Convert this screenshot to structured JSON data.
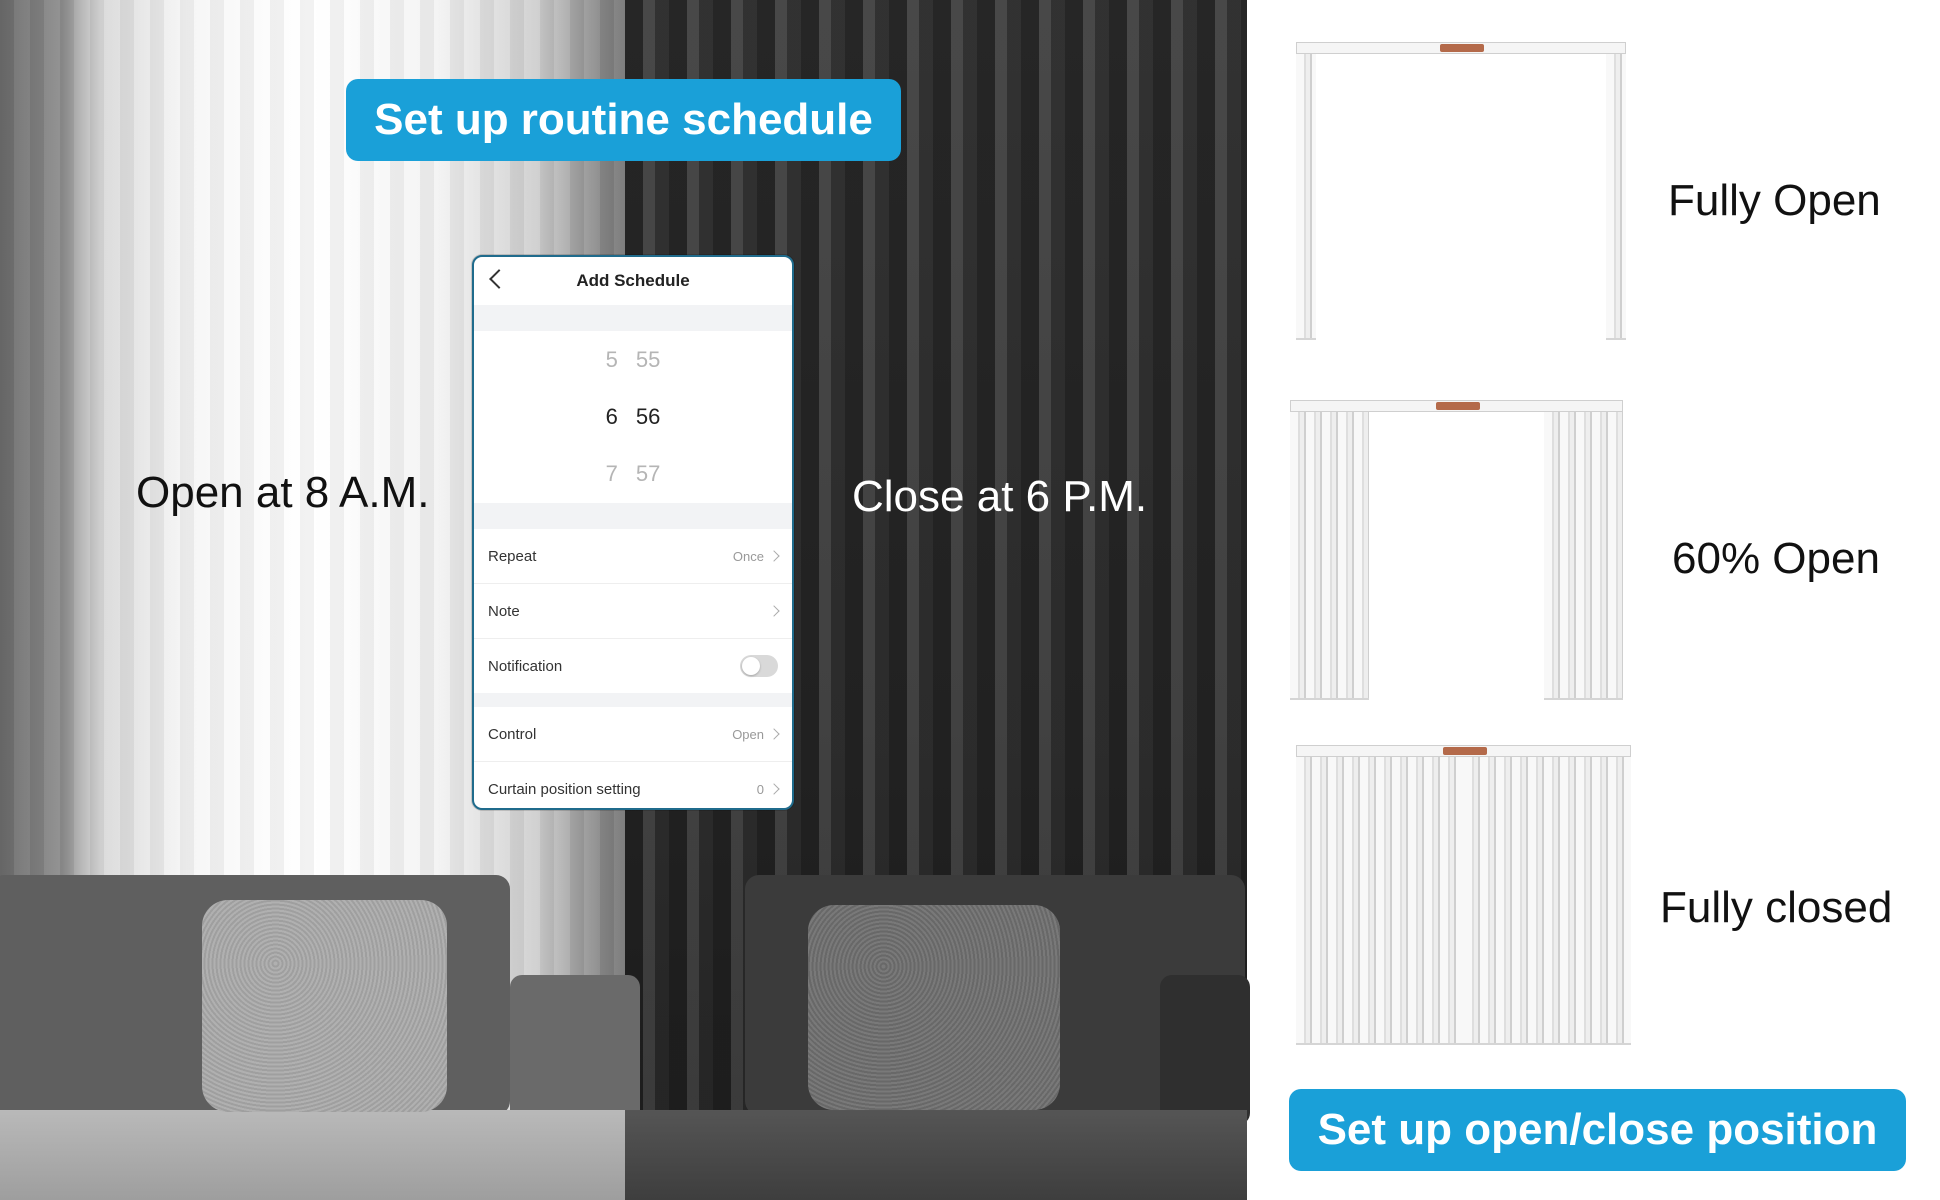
{
  "banners": {
    "schedule": "Set up routine schedule",
    "position": "Set up open/close position"
  },
  "captions": {
    "open_time": "Open at 8 A.M.",
    "close_time": "Close at 6 P.M."
  },
  "phone": {
    "title": "Add Schedule",
    "picker": {
      "rows": [
        {
          "hour": "5",
          "minute": "55"
        },
        {
          "hour": "6",
          "minute": "56"
        },
        {
          "hour": "7",
          "minute": "57"
        }
      ],
      "selected_index": 1
    },
    "settings": {
      "repeat": {
        "label": "Repeat",
        "value": "Once"
      },
      "note": {
        "label": "Note"
      },
      "notification": {
        "label": "Notification",
        "enabled": false
      },
      "control": {
        "label": "Control",
        "value": "Open"
      },
      "curtain_pos": {
        "label": "Curtain position setting",
        "value": "0"
      }
    }
  },
  "curtain_states": [
    {
      "label": "Fully Open",
      "open_fraction": 1.0
    },
    {
      "label": "60% Open",
      "open_fraction": 0.6
    },
    {
      "label": "Fully closed",
      "open_fraction": 0.0
    }
  ],
  "colors": {
    "accent": "#1aa0d8",
    "motor": "#b46a4a"
  }
}
